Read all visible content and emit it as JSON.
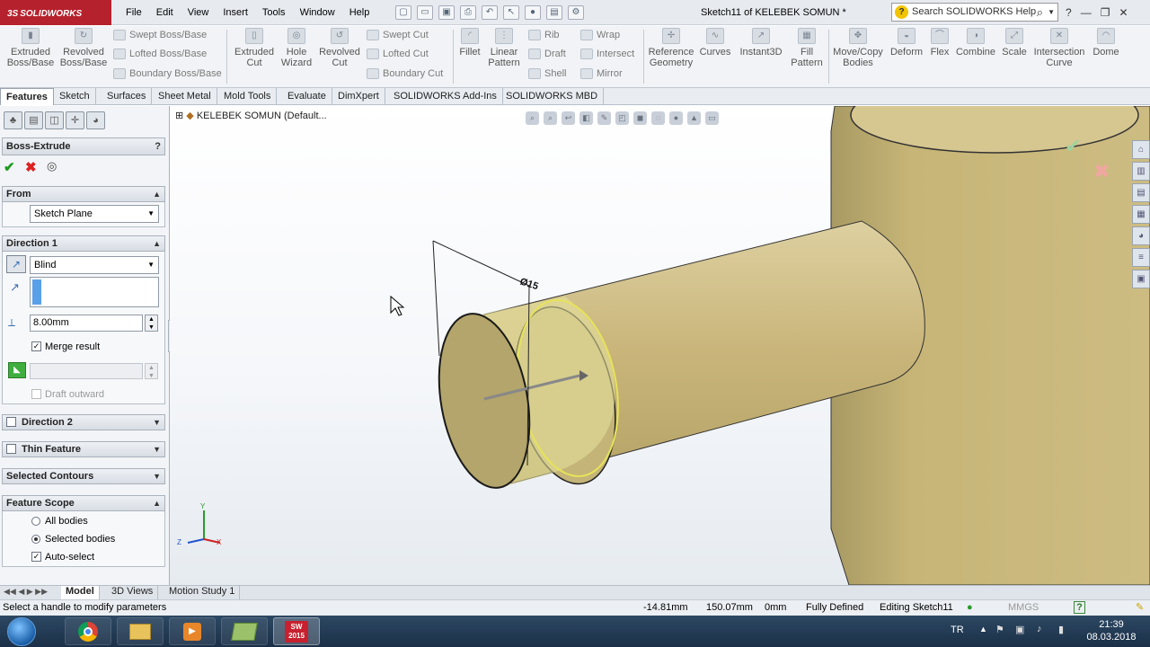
{
  "app": {
    "brand": "SOLIDWORKS",
    "doc_title": "Sketch11 of KELEBEK SOMUN *"
  },
  "menu": [
    "File",
    "Edit",
    "View",
    "Insert",
    "Tools",
    "Window",
    "Help"
  ],
  "search": {
    "placeholder": "Search SOLIDWORKS Help"
  },
  "ribbon": {
    "extruded_boss": "Extruded Boss/Base",
    "revolved_boss": "Revolved Boss/Base",
    "swept_boss": "Swept Boss/Base",
    "lofted_boss": "Lofted Boss/Base",
    "boundary_boss": "Boundary Boss/Base",
    "extruded_cut": "Extruded Cut",
    "hole_wizard": "Hole Wizard",
    "revolved_cut": "Revolved Cut",
    "swept_cut": "Swept Cut",
    "lofted_cut": "Lofted Cut",
    "boundary_cut": "Boundary Cut",
    "fillet": "Fillet",
    "linear_pattern": "Linear Pattern",
    "rib": "Rib",
    "draft": "Draft",
    "shell": "Shell",
    "wrap": "Wrap",
    "intersect": "Intersect",
    "mirror": "Mirror",
    "reference_geometry": "Reference Geometry",
    "curves": "Curves",
    "instant3d": "Instant3D",
    "fill_pattern": "Fill Pattern",
    "move_copy": "Move/Copy Bodies",
    "deform": "Deform",
    "flex": "Flex",
    "combine": "Combine",
    "scale": "Scale",
    "intersection_curve": "Intersection Curve",
    "dome": "Dome"
  },
  "tabs": [
    "Features",
    "Sketch",
    "Surfaces",
    "Sheet Metal",
    "Mold Tools",
    "Evaluate",
    "DimXpert",
    "SOLIDWORKS Add-Ins",
    "SOLIDWORKS MBD"
  ],
  "property_manager": {
    "title": "Boss-Extrude",
    "help": "?",
    "from": {
      "header": "From",
      "value": "Sketch Plane"
    },
    "direction1": {
      "header": "Direction 1",
      "end_condition": "Blind",
      "depth": "8.00mm",
      "merge_result": "Merge result",
      "draft_outward": "Draft outward"
    },
    "direction2": {
      "header": "Direction 2"
    },
    "thin_feature": {
      "header": "Thin Feature"
    },
    "selected_contours": {
      "header": "Selected Contours"
    },
    "feature_scope": {
      "header": "Feature Scope",
      "all_bodies": "All bodies",
      "selected_bodies": "Selected bodies",
      "auto_select": "Auto-select"
    }
  },
  "viewport": {
    "tree_label": "KELEBEK SOMUN  (Default...",
    "dimension": "Ø15"
  },
  "bottom_tabs": [
    "Model",
    "3D Views",
    "Motion Study 1"
  ],
  "status": {
    "message": "Select a handle to modify parameters",
    "x": "-14.81mm",
    "y": "150.07mm",
    "z": "0mm",
    "state": "Fully Defined",
    "editing": "Editing Sketch11",
    "units": "MMGS",
    "help": "?"
  },
  "taskbar": {
    "lang": "TR",
    "time": "21:39",
    "date": "08.03.2018",
    "sw_badge": "2015"
  },
  "colors": {
    "accent_red": "#b5212d",
    "body_tan": "#c9b37a",
    "preview_yellow": "#e6e35a"
  }
}
